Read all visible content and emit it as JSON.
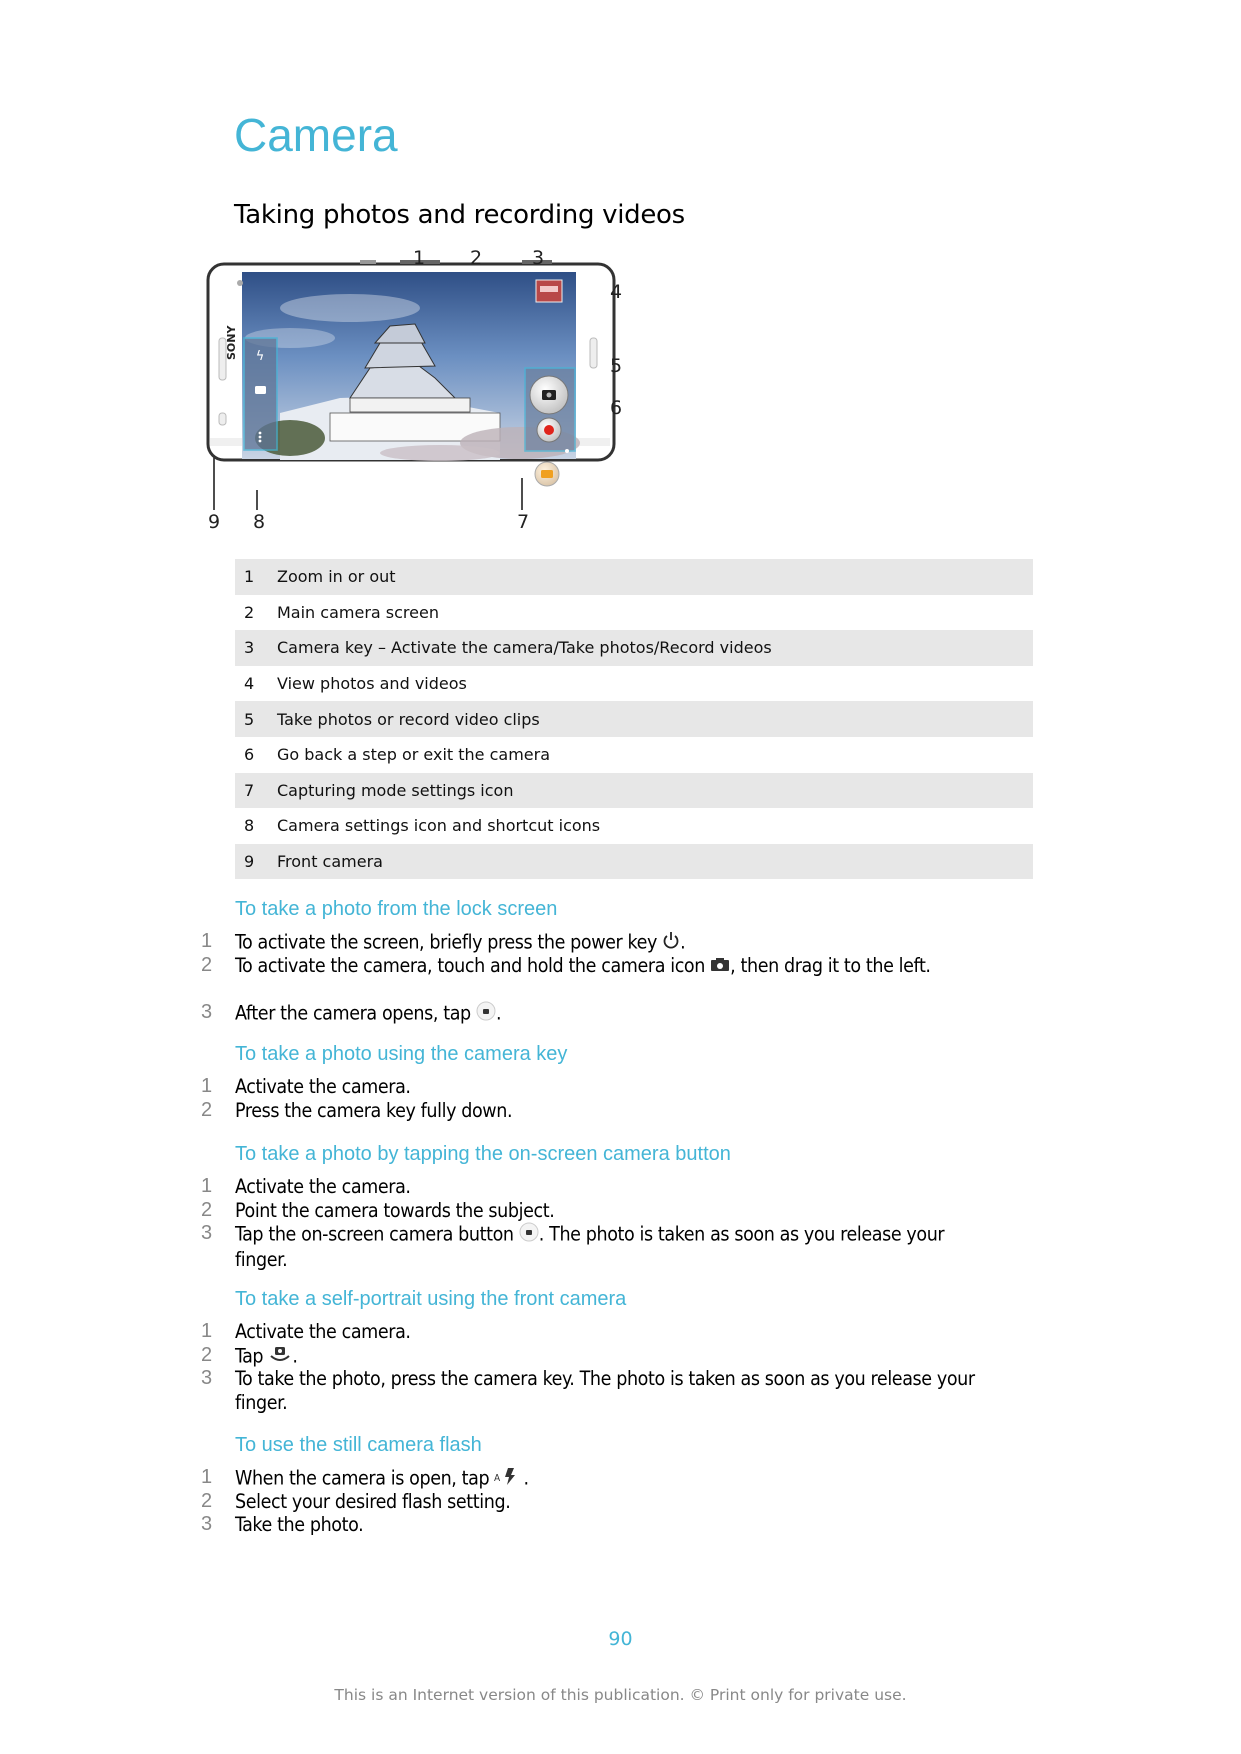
{
  "page": {
    "title": "Camera",
    "subtitle": "Taking photos and recording videos",
    "page_number": "90",
    "footer": "This is an Internet version of this publication. © Print only for private use."
  },
  "figure": {
    "brand": "SONY",
    "callouts": [
      "1",
      "2",
      "3",
      "4",
      "5",
      "6",
      "7",
      "8",
      "9"
    ],
    "accent_color": "#44b5d6"
  },
  "legend_table": [
    {
      "num": "1",
      "text": "Zoom in or out"
    },
    {
      "num": "2",
      "text": "Main camera screen"
    },
    {
      "num": "3",
      "text": "Camera key – Activate the camera/Take photos/Record videos"
    },
    {
      "num": "4",
      "text": "View photos and videos"
    },
    {
      "num": "5",
      "text": "Take photos or record video clips"
    },
    {
      "num": "6",
      "text": "Go back a step or exit the camera"
    },
    {
      "num": "7",
      "text": "Capturing mode settings icon"
    },
    {
      "num": "8",
      "text": "Camera settings icon and shortcut icons"
    },
    {
      "num": "9",
      "text": "Front camera"
    }
  ],
  "sections": [
    {
      "heading": "To take a photo from the lock screen",
      "steps": [
        {
          "num": "1",
          "before": "To activate the screen, briefly press the power key ",
          "icon": "power-icon",
          "after": "."
        },
        {
          "num": "2",
          "before": "To activate the camera, touch and hold the camera icon ",
          "icon": "camera-icon",
          "after": ", then drag it to the left."
        },
        {
          "num": "3",
          "before": "After the camera opens, tap ",
          "icon": "shutter-button-icon",
          "after": "."
        }
      ]
    },
    {
      "heading": "To take a photo using the camera key",
      "steps": [
        {
          "num": "1",
          "before": "Activate the camera.",
          "icon": "",
          "after": ""
        },
        {
          "num": "2",
          "before": "Press the camera key fully down.",
          "icon": "",
          "after": ""
        }
      ]
    },
    {
      "heading": "To take a photo by tapping the on-screen camera button",
      "steps": [
        {
          "num": "1",
          "before": "Activate the camera.",
          "icon": "",
          "after": ""
        },
        {
          "num": "2",
          "before": "Point the camera towards the subject.",
          "icon": "",
          "after": ""
        },
        {
          "num": "3",
          "before": "Tap the on-screen camera button ",
          "icon": "shutter-button-icon",
          "after": ". The photo is taken as soon as you release your finger."
        }
      ]
    },
    {
      "heading": "To take a self-portrait using the front camera",
      "steps": [
        {
          "num": "1",
          "before": "Activate the camera.",
          "icon": "",
          "after": ""
        },
        {
          "num": "2",
          "before": "Tap ",
          "icon": "switch-camera-icon",
          "after": "."
        },
        {
          "num": "3",
          "before": "To take the photo, press the camera key. The photo is taken as soon as you release your finger.",
          "icon": "",
          "after": ""
        }
      ]
    },
    {
      "heading": "To use the still camera flash",
      "steps": [
        {
          "num": "1",
          "before": "When the camera is open, tap ",
          "icon": "auto-flash-icon",
          "after": " ."
        },
        {
          "num": "2",
          "before": "Select your desired flash setting.",
          "icon": "",
          "after": ""
        },
        {
          "num": "3",
          "before": "Take the photo.",
          "icon": "",
          "after": ""
        }
      ]
    }
  ]
}
